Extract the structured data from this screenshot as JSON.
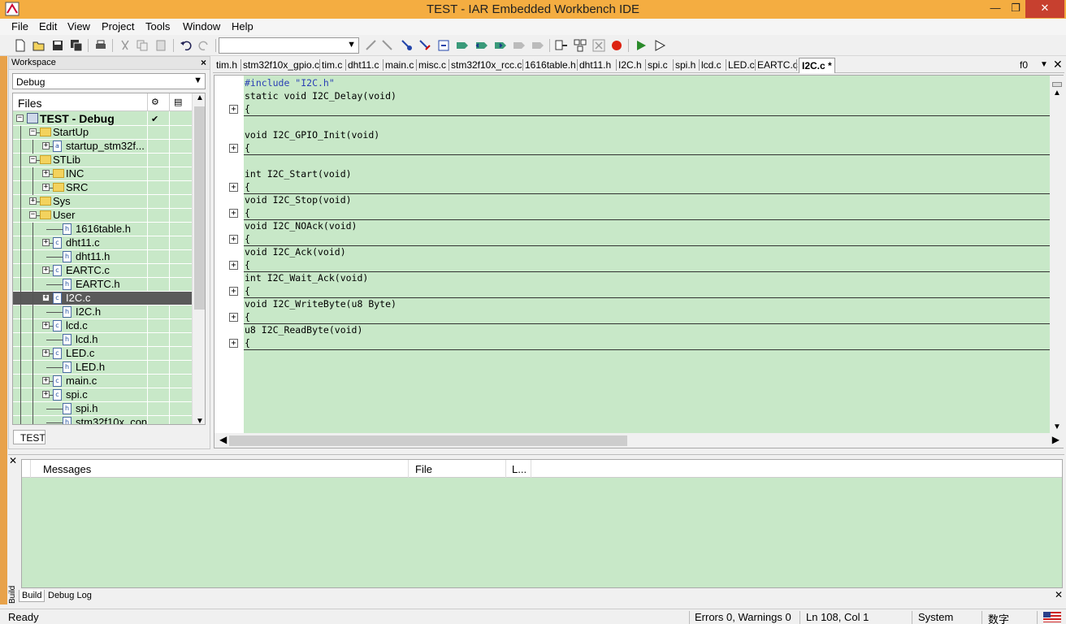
{
  "window": {
    "title": "TEST - IAR Embedded Workbench IDE",
    "controls": {
      "minimize": "—",
      "maximize": "❐",
      "close": "✕"
    }
  },
  "menu": [
    "File",
    "Edit",
    "View",
    "Project",
    "Tools",
    "Window",
    "Help"
  ],
  "toolbar": {
    "combo_value": ""
  },
  "workspace": {
    "header": "Workspace",
    "config": "Debug",
    "files_header": "Files",
    "tab": "TEST",
    "tree": [
      {
        "label": "TEST - Debug",
        "kind": "project",
        "level": 0,
        "expand": "−",
        "bold": true,
        "check": "✔"
      },
      {
        "label": "StartUp",
        "kind": "folder",
        "level": 1,
        "expand": "−"
      },
      {
        "label": "startup_stm32f...",
        "kind": "asm",
        "level": 2,
        "expand": "+"
      },
      {
        "label": "STLib",
        "kind": "folder",
        "level": 1,
        "expand": "−"
      },
      {
        "label": "INC",
        "kind": "folder",
        "level": 2,
        "expand": "+"
      },
      {
        "label": "SRC",
        "kind": "folder",
        "level": 2,
        "expand": "+"
      },
      {
        "label": "Sys",
        "kind": "folder",
        "level": 1,
        "expand": "+"
      },
      {
        "label": "User",
        "kind": "folder",
        "level": 1,
        "expand": "−"
      },
      {
        "label": "1616table.h",
        "kind": "h",
        "level": 2,
        "expand": ""
      },
      {
        "label": "dht11.c",
        "kind": "c",
        "level": 2,
        "expand": "+"
      },
      {
        "label": "dht11.h",
        "kind": "h",
        "level": 2,
        "expand": ""
      },
      {
        "label": "EARTC.c",
        "kind": "c",
        "level": 2,
        "expand": "+"
      },
      {
        "label": "EARTC.h",
        "kind": "h",
        "level": 2,
        "expand": ""
      },
      {
        "label": "I2C.c",
        "kind": "c",
        "level": 2,
        "expand": "+",
        "selected": true
      },
      {
        "label": "I2C.h",
        "kind": "h",
        "level": 2,
        "expand": ""
      },
      {
        "label": "lcd.c",
        "kind": "c",
        "level": 2,
        "expand": "+"
      },
      {
        "label": "lcd.h",
        "kind": "h",
        "level": 2,
        "expand": ""
      },
      {
        "label": "LED.c",
        "kind": "c",
        "level": 2,
        "expand": "+"
      },
      {
        "label": "LED.h",
        "kind": "h",
        "level": 2,
        "expand": ""
      },
      {
        "label": "main.c",
        "kind": "c",
        "level": 2,
        "expand": "+"
      },
      {
        "label": "spi.c",
        "kind": "c",
        "level": 2,
        "expand": "+"
      },
      {
        "label": "spi.h",
        "kind": "h",
        "level": 2,
        "expand": ""
      },
      {
        "label": "stm32f10x_con...",
        "kind": "h",
        "level": 2,
        "expand": ""
      }
    ]
  },
  "editor": {
    "tabs": [
      "tim.h",
      "stm32f10x_gpio.c",
      "tim.c",
      "dht11.c",
      "main.c",
      "misc.c",
      "stm32f10x_rcc.c",
      "1616table.h",
      "dht11.h",
      "I2C.h",
      "spi.c",
      "spi.h",
      "lcd.c",
      "LED.c",
      "EARTC.c",
      "I2C.c *"
    ],
    "active_tab": "I2C.c *",
    "function_dropdown": "f0",
    "lines": [
      {
        "text": "#include \"I2C.h\"",
        "pp": true
      },
      {
        "text": "static void I2C_Delay(void)"
      },
      {
        "text": "{",
        "fold": true,
        "rule": true
      },
      {
        "text": ""
      },
      {
        "text": "void I2C_GPIO_Init(void)"
      },
      {
        "text": "{",
        "fold": true,
        "rule": true
      },
      {
        "text": ""
      },
      {
        "text": "int I2C_Start(void)"
      },
      {
        "text": "{",
        "fold": true,
        "rule": true
      },
      {
        "text": "void I2C_Stop(void)"
      },
      {
        "text": "{",
        "fold": true,
        "rule": true
      },
      {
        "text": "void I2C_NOAck(void)"
      },
      {
        "text": "{",
        "fold": true,
        "rule": true
      },
      {
        "text": "void I2C_Ack(void)"
      },
      {
        "text": "{",
        "fold": true,
        "rule": true
      },
      {
        "text": "int I2C_Wait_Ack(void)"
      },
      {
        "text": "{",
        "fold": true,
        "rule": true
      },
      {
        "text": "void I2C_WriteByte(u8 Byte)"
      },
      {
        "text": "{",
        "fold": true,
        "rule": true
      },
      {
        "text": "u8 I2C_ReadByte(void)"
      },
      {
        "text": "{",
        "fold": true,
        "rule": true
      }
    ]
  },
  "messages": {
    "columns": [
      "Messages",
      "File",
      "L..."
    ],
    "side_label": "Build",
    "tabs": [
      "Build",
      "Debug Log"
    ]
  },
  "status": {
    "ready": "Ready",
    "errors": "Errors 0, Warnings 0",
    "position": "Ln 108, Col 1",
    "system": "System",
    "ime": "数字"
  }
}
